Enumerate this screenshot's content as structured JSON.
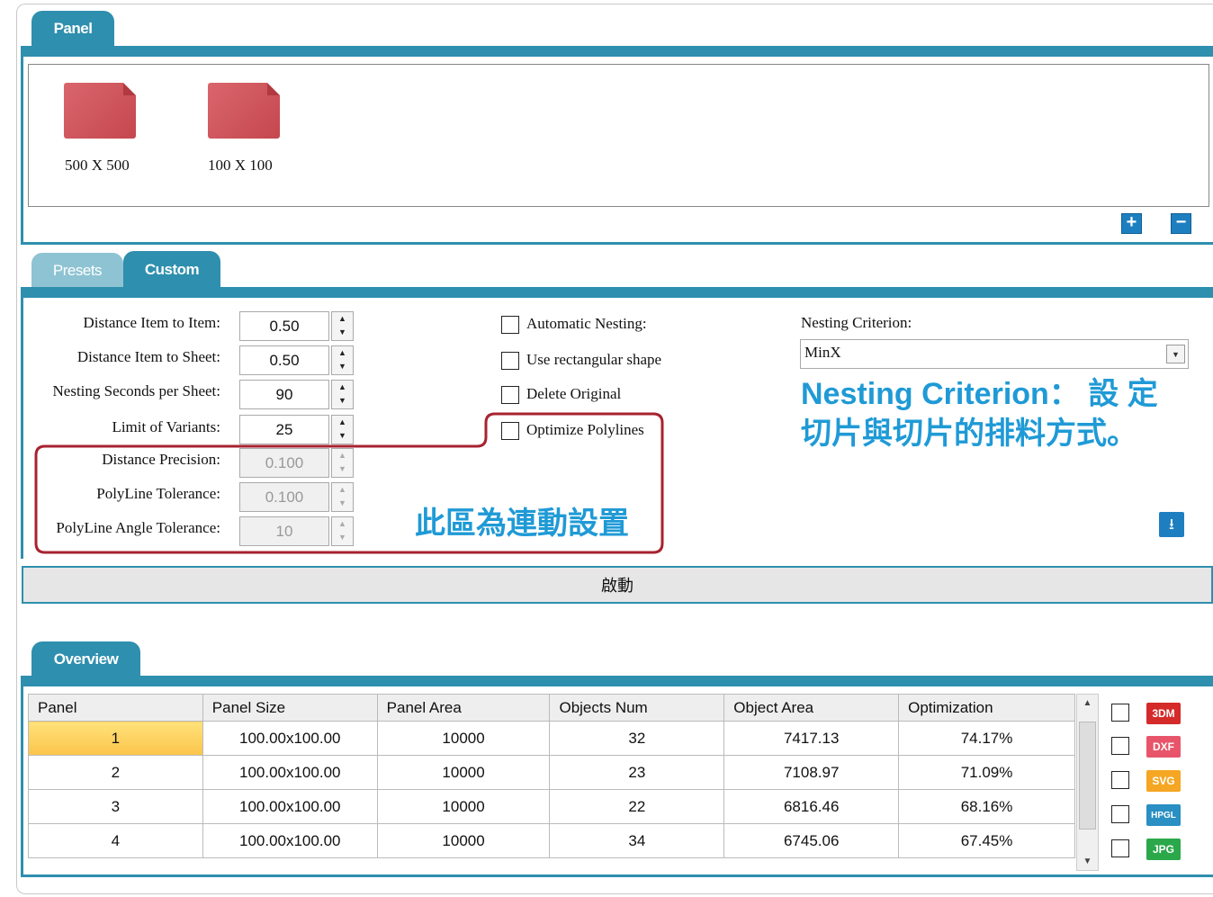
{
  "panel_tab": "Panel",
  "panels": [
    {
      "label": "500 X 500"
    },
    {
      "label": "100 X 100"
    }
  ],
  "add_icon": "+",
  "remove_icon": "−",
  "settings_tabs": [
    "Presets",
    "Custom"
  ],
  "fields": [
    {
      "label": "Distance Item to Item:",
      "value": "0.50"
    },
    {
      "label": "Distance Item to Sheet:",
      "value": "0.50"
    },
    {
      "label": "Nesting Seconds per Sheet:",
      "value": "90"
    },
    {
      "label": "Limit of Variants:",
      "value": "25"
    },
    {
      "label": "Distance Precision:",
      "value": "0.100"
    },
    {
      "label": "PolyLine Tolerance:",
      "value": "0.100"
    },
    {
      "label": "PolyLine Angle Tolerance:",
      "value": "10"
    }
  ],
  "checkboxes": [
    {
      "label": "Automatic Nesting:"
    },
    {
      "label": "Use rectangular shape"
    },
    {
      "label": "Delete Original"
    },
    {
      "label": "Optimize Polylines"
    }
  ],
  "criterion": {
    "label": "Nesting Criterion:",
    "value": "MinX"
  },
  "annotation_criterion": {
    "line1": "Nesting Criterion： 設 定",
    "line2": "切片與切片的排料方式。"
  },
  "annotation_linked": "此區為連動設置",
  "start_button": "啟動",
  "overview_tab": "Overview",
  "table": {
    "headers": [
      "Panel",
      "Panel Size",
      "Panel Area",
      "Objects Num",
      "Object Area",
      "Optimization"
    ],
    "rows": [
      [
        "1",
        "100.00x100.00",
        "10000",
        "32",
        "7417.13",
        "74.17%"
      ],
      [
        "2",
        "100.00x100.00",
        "10000",
        "23",
        "7108.97",
        "71.09%"
      ],
      [
        "3",
        "100.00x100.00",
        "10000",
        "22",
        "6816.46",
        "68.16%"
      ],
      [
        "4",
        "100.00x100.00",
        "10000",
        "34",
        "6745.06",
        "67.45%"
      ]
    ]
  },
  "formats": [
    {
      "label": "3DM",
      "color": "#d42a2a"
    },
    {
      "label": "DXF",
      "color": "#e8556a"
    },
    {
      "label": "SVG",
      "color": "#f5a623"
    },
    {
      "label": "HPGL",
      "color": "#2a8fc2"
    },
    {
      "label": "JPG",
      "color": "#2aa84a"
    }
  ]
}
